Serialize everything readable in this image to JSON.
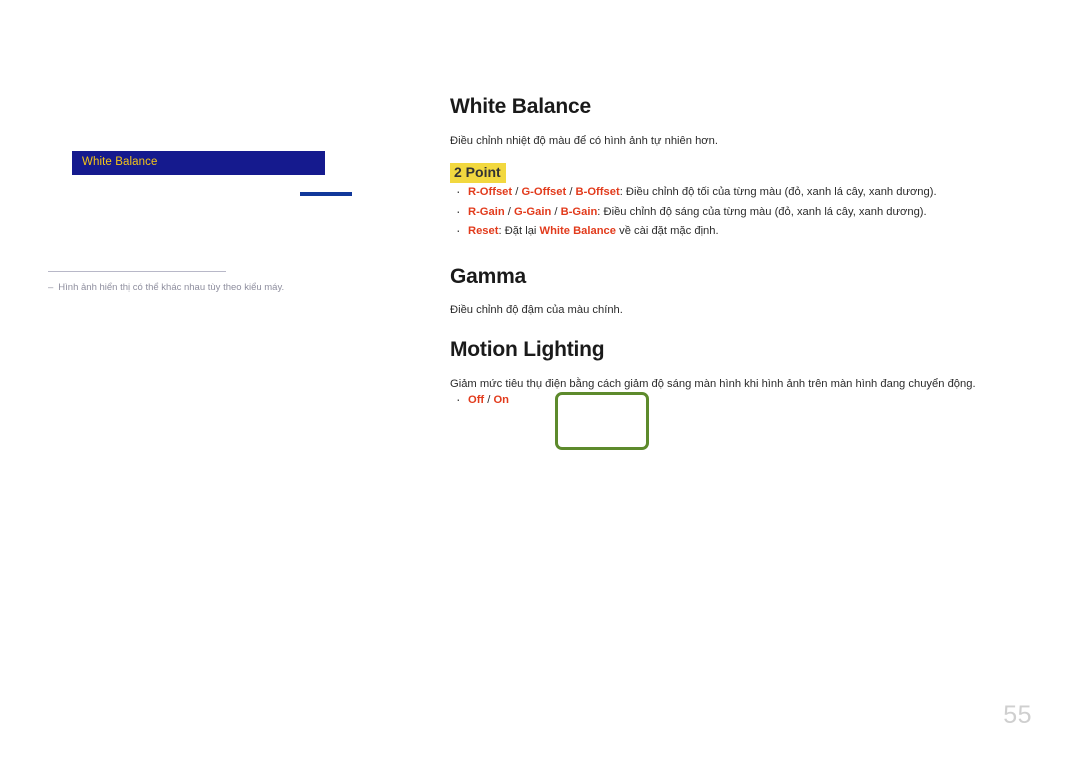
{
  "document": {
    "page_number": "55",
    "accents": {
      "menu_chip_bg": "#151a8e",
      "menu_chip_text": "#f4c518",
      "menu_underline": "#11389a",
      "highlight_bg": "#f2d83f",
      "keyword_red": "#e23b1c",
      "annotation_green": "#5d8a2c",
      "note_gray": "#8e8e9e",
      "page_number_gray": "#cfcfcf"
    }
  },
  "left_panel": {
    "menu_chip_label": "White Balance",
    "note_dash": "‒",
    "note_text": "Hình ảnh hiển thị có thể khác nhau tùy theo kiểu máy."
  },
  "sections": {
    "white_balance": {
      "heading": "White Balance",
      "description": "Điều chỉnh nhiệt độ màu để có hình ảnh tự nhiên hơn.",
      "subheading": "2 Point",
      "bullets": [
        {
          "terms": [
            "R-Offset",
            "G-Offset",
            "B-Offset"
          ],
          "separator": " / ",
          "colon": ": ",
          "text": "Điều chỉnh độ tối của từng màu (đỏ, xanh lá cây, xanh dương)."
        },
        {
          "terms": [
            "R-Gain",
            "G-Gain",
            "B-Gain"
          ],
          "separator": " / ",
          "colon": ": ",
          "text": "Điều chỉnh độ sáng của từng màu (đỏ, xanh lá cây, xanh dương)."
        },
        {
          "terms": [
            "Reset"
          ],
          "separator": " / ",
          "colon": ": ",
          "text_before": "Đặt lại ",
          "inline_term": "White Balance",
          "text_after": " về cài đặt mặc định."
        }
      ]
    },
    "gamma": {
      "heading": "Gamma",
      "description": "Điều chỉnh độ đậm của màu chính."
    },
    "motion_lighting": {
      "heading": "Motion Lighting",
      "description": "Giảm mức tiêu thụ điện bằng cách giảm độ sáng màn hình khi hình ảnh trên màn hình đang chuyển động.",
      "bullets": [
        {
          "terms": [
            "Off",
            "On"
          ],
          "separator": " / ",
          "colon": "",
          "text": ""
        }
      ]
    }
  }
}
